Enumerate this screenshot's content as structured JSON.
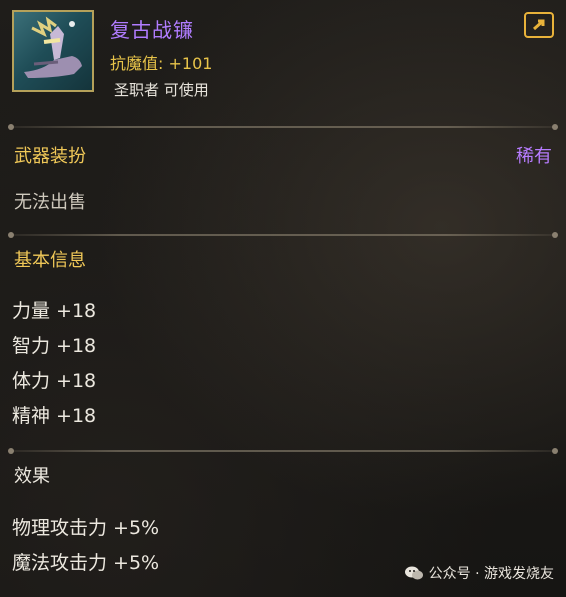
{
  "item": {
    "name": "复古战镰",
    "resist_label": "抗魔值:",
    "resist_value": "+101",
    "usable_by": "圣职者 可使用",
    "icon": "scythe-item-icon"
  },
  "header": {
    "link_icon": "share-link-icon"
  },
  "type_section": {
    "title": "武器装扮",
    "rarity": "稀有",
    "sell_status": "无法出售"
  },
  "basic_info": {
    "title": "基本信息",
    "stats": [
      "力量 +18",
      "智力 +18",
      "体力 +18",
      "精神 +18"
    ]
  },
  "effects": {
    "title": "效果",
    "items": [
      "物理攻击力 +5%",
      "魔法攻击力 +5%"
    ]
  },
  "watermark": {
    "text": "公众号 · 游戏发烧友",
    "icon": "wechat-icon"
  },
  "colors": {
    "rarity_purple": "#b07cff",
    "gold": "#f0c858",
    "resist_yellow": "#e8c44a"
  }
}
